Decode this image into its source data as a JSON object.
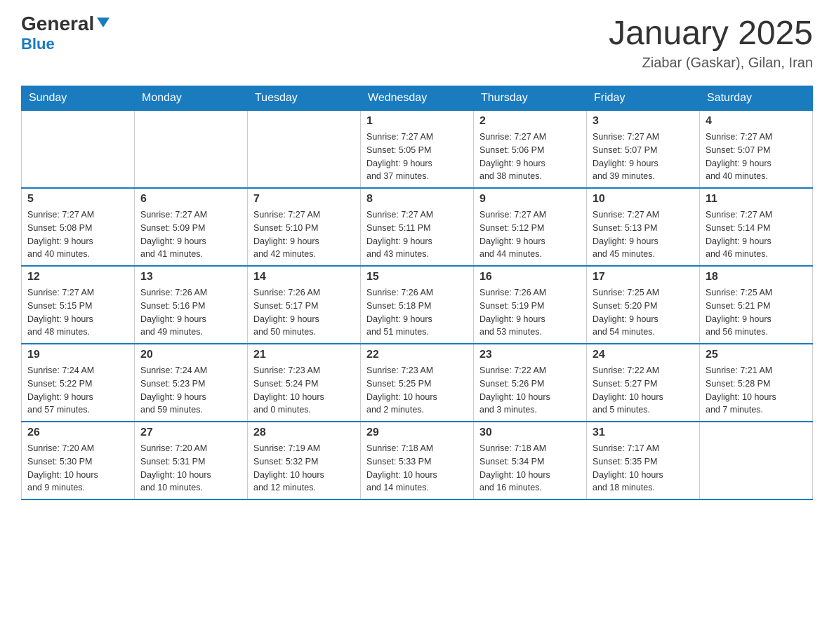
{
  "logo": {
    "general": "General",
    "blue": "Blue",
    "arrow": "▼"
  },
  "title": "January 2025",
  "location": "Ziabar (Gaskar), Gilan, Iran",
  "weekdays": [
    "Sunday",
    "Monday",
    "Tuesday",
    "Wednesday",
    "Thursday",
    "Friday",
    "Saturday"
  ],
  "weeks": [
    [
      {
        "day": "",
        "info": ""
      },
      {
        "day": "",
        "info": ""
      },
      {
        "day": "",
        "info": ""
      },
      {
        "day": "1",
        "info": "Sunrise: 7:27 AM\nSunset: 5:05 PM\nDaylight: 9 hours\nand 37 minutes."
      },
      {
        "day": "2",
        "info": "Sunrise: 7:27 AM\nSunset: 5:06 PM\nDaylight: 9 hours\nand 38 minutes."
      },
      {
        "day": "3",
        "info": "Sunrise: 7:27 AM\nSunset: 5:07 PM\nDaylight: 9 hours\nand 39 minutes."
      },
      {
        "day": "4",
        "info": "Sunrise: 7:27 AM\nSunset: 5:07 PM\nDaylight: 9 hours\nand 40 minutes."
      }
    ],
    [
      {
        "day": "5",
        "info": "Sunrise: 7:27 AM\nSunset: 5:08 PM\nDaylight: 9 hours\nand 40 minutes."
      },
      {
        "day": "6",
        "info": "Sunrise: 7:27 AM\nSunset: 5:09 PM\nDaylight: 9 hours\nand 41 minutes."
      },
      {
        "day": "7",
        "info": "Sunrise: 7:27 AM\nSunset: 5:10 PM\nDaylight: 9 hours\nand 42 minutes."
      },
      {
        "day": "8",
        "info": "Sunrise: 7:27 AM\nSunset: 5:11 PM\nDaylight: 9 hours\nand 43 minutes."
      },
      {
        "day": "9",
        "info": "Sunrise: 7:27 AM\nSunset: 5:12 PM\nDaylight: 9 hours\nand 44 minutes."
      },
      {
        "day": "10",
        "info": "Sunrise: 7:27 AM\nSunset: 5:13 PM\nDaylight: 9 hours\nand 45 minutes."
      },
      {
        "day": "11",
        "info": "Sunrise: 7:27 AM\nSunset: 5:14 PM\nDaylight: 9 hours\nand 46 minutes."
      }
    ],
    [
      {
        "day": "12",
        "info": "Sunrise: 7:27 AM\nSunset: 5:15 PM\nDaylight: 9 hours\nand 48 minutes."
      },
      {
        "day": "13",
        "info": "Sunrise: 7:26 AM\nSunset: 5:16 PM\nDaylight: 9 hours\nand 49 minutes."
      },
      {
        "day": "14",
        "info": "Sunrise: 7:26 AM\nSunset: 5:17 PM\nDaylight: 9 hours\nand 50 minutes."
      },
      {
        "day": "15",
        "info": "Sunrise: 7:26 AM\nSunset: 5:18 PM\nDaylight: 9 hours\nand 51 minutes."
      },
      {
        "day": "16",
        "info": "Sunrise: 7:26 AM\nSunset: 5:19 PM\nDaylight: 9 hours\nand 53 minutes."
      },
      {
        "day": "17",
        "info": "Sunrise: 7:25 AM\nSunset: 5:20 PM\nDaylight: 9 hours\nand 54 minutes."
      },
      {
        "day": "18",
        "info": "Sunrise: 7:25 AM\nSunset: 5:21 PM\nDaylight: 9 hours\nand 56 minutes."
      }
    ],
    [
      {
        "day": "19",
        "info": "Sunrise: 7:24 AM\nSunset: 5:22 PM\nDaylight: 9 hours\nand 57 minutes."
      },
      {
        "day": "20",
        "info": "Sunrise: 7:24 AM\nSunset: 5:23 PM\nDaylight: 9 hours\nand 59 minutes."
      },
      {
        "day": "21",
        "info": "Sunrise: 7:23 AM\nSunset: 5:24 PM\nDaylight: 10 hours\nand 0 minutes."
      },
      {
        "day": "22",
        "info": "Sunrise: 7:23 AM\nSunset: 5:25 PM\nDaylight: 10 hours\nand 2 minutes."
      },
      {
        "day": "23",
        "info": "Sunrise: 7:22 AM\nSunset: 5:26 PM\nDaylight: 10 hours\nand 3 minutes."
      },
      {
        "day": "24",
        "info": "Sunrise: 7:22 AM\nSunset: 5:27 PM\nDaylight: 10 hours\nand 5 minutes."
      },
      {
        "day": "25",
        "info": "Sunrise: 7:21 AM\nSunset: 5:28 PM\nDaylight: 10 hours\nand 7 minutes."
      }
    ],
    [
      {
        "day": "26",
        "info": "Sunrise: 7:20 AM\nSunset: 5:30 PM\nDaylight: 10 hours\nand 9 minutes."
      },
      {
        "day": "27",
        "info": "Sunrise: 7:20 AM\nSunset: 5:31 PM\nDaylight: 10 hours\nand 10 minutes."
      },
      {
        "day": "28",
        "info": "Sunrise: 7:19 AM\nSunset: 5:32 PM\nDaylight: 10 hours\nand 12 minutes."
      },
      {
        "day": "29",
        "info": "Sunrise: 7:18 AM\nSunset: 5:33 PM\nDaylight: 10 hours\nand 14 minutes."
      },
      {
        "day": "30",
        "info": "Sunrise: 7:18 AM\nSunset: 5:34 PM\nDaylight: 10 hours\nand 16 minutes."
      },
      {
        "day": "31",
        "info": "Sunrise: 7:17 AM\nSunset: 5:35 PM\nDaylight: 10 hours\nand 18 minutes."
      },
      {
        "day": "",
        "info": ""
      }
    ]
  ]
}
